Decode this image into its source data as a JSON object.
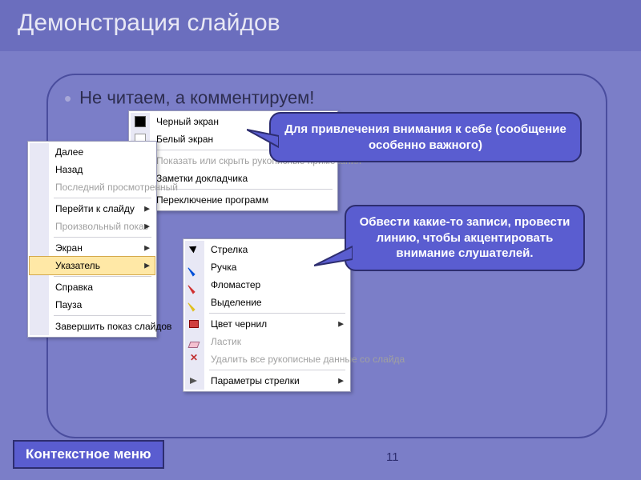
{
  "title": "Демонстрация слайдов",
  "bullet": "Не читаем, а комментируем!",
  "callout1": "Для привлечения  внимания к себе (сообщение особенно важного)",
  "callout2": "Обвести какие-то записи, провести линию, чтобы акцентировать внимание слушателей.",
  "footer_label": "Контекстное меню",
  "page_number": "11",
  "menu1": {
    "next": "Далее",
    "back": "Назад",
    "last": "Последний просмотренный",
    "goto": "Перейти к слайду",
    "custom": "Произвольный показ",
    "screen": "Экран",
    "pointer": "Указатель",
    "help": "Справка",
    "pause": "Пауза",
    "end": "Завершить показ слайдов"
  },
  "menu2": {
    "black": "Черный экран",
    "white": "Белый экран",
    "ink": "Показать или скрыть рукописные примечания",
    "notes": "Заметки докладчика",
    "switch": "Переключение программ"
  },
  "menu3": {
    "arrow": "Стрелка",
    "pen": "Ручка",
    "marker": "Фломастер",
    "highlight": "Выделение",
    "inkcolor": "Цвет чернил",
    "eraser": "Ластик",
    "delete": "Удалить все рукописные данные со слайда",
    "arrowopts": "Параметры стрелки"
  }
}
